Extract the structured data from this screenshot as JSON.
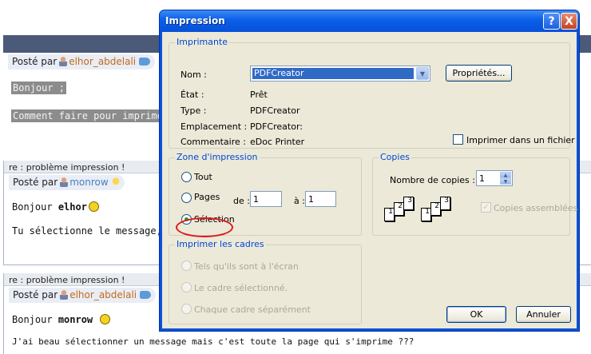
{
  "forum": {
    "post1": {
      "posted_by": "Posté par",
      "author": "elhor_abdelali",
      "line1": "Bonjour ;",
      "line2": "Comment faire pour imprimer u"
    },
    "post2": {
      "title": "re : problème impression !",
      "posted_by": "Posté par",
      "author": "monrow",
      "greeting": "Bonjour",
      "greeting_name": "elhor",
      "line1": "Tu sélectionne le message, puis"
    },
    "post3": {
      "title": "re : problème impression !",
      "posted_by": "Posté par",
      "author": "elhor_abdelali",
      "greeting": "Bonjour",
      "greeting_name": "monrow",
      "line_partial": "J'ai beau sélectionner un message mais c'est toute la page qui s'imprime ???"
    }
  },
  "dialog": {
    "title": "Impression",
    "help_glyph": "?",
    "close_glyph": "X",
    "printer": {
      "group_title": "Imprimante",
      "name_label": "Nom :",
      "name_value": "PDFCreator",
      "properties_button": "Propriétés...",
      "state_label": "État :",
      "state_value": "Prêt",
      "type_label": "Type :",
      "type_value": "PDFCreator",
      "location_label": "Emplacement :",
      "location_value": "PDFCreator:",
      "comment_label": "Commentaire :",
      "comment_value": "eDoc Printer",
      "print_to_file_label": "Imprimer dans un fichier"
    },
    "print_range": {
      "group_title": "Zone d'impression",
      "all_label": "Tout",
      "pages_label": "Pages",
      "from_label": "de :",
      "from_value": "1",
      "to_label": "à :",
      "to_value": "1",
      "selection_label": "Sélection",
      "selected": "selection"
    },
    "copies": {
      "group_title": "Copies",
      "count_label": "Nombre de copies :",
      "count_value": "1",
      "collate_label": "Copies assemblées",
      "collate_checked": true,
      "collate_enabled": false
    },
    "frames": {
      "group_title": "Imprimer les cadres",
      "option1": "Tels qu'ils sont à l'écran",
      "option2": "Le cadre sélectionné.",
      "option3": "Chaque cadre séparément",
      "enabled": false
    },
    "ok_button": "OK",
    "cancel_button": "Annuler"
  }
}
